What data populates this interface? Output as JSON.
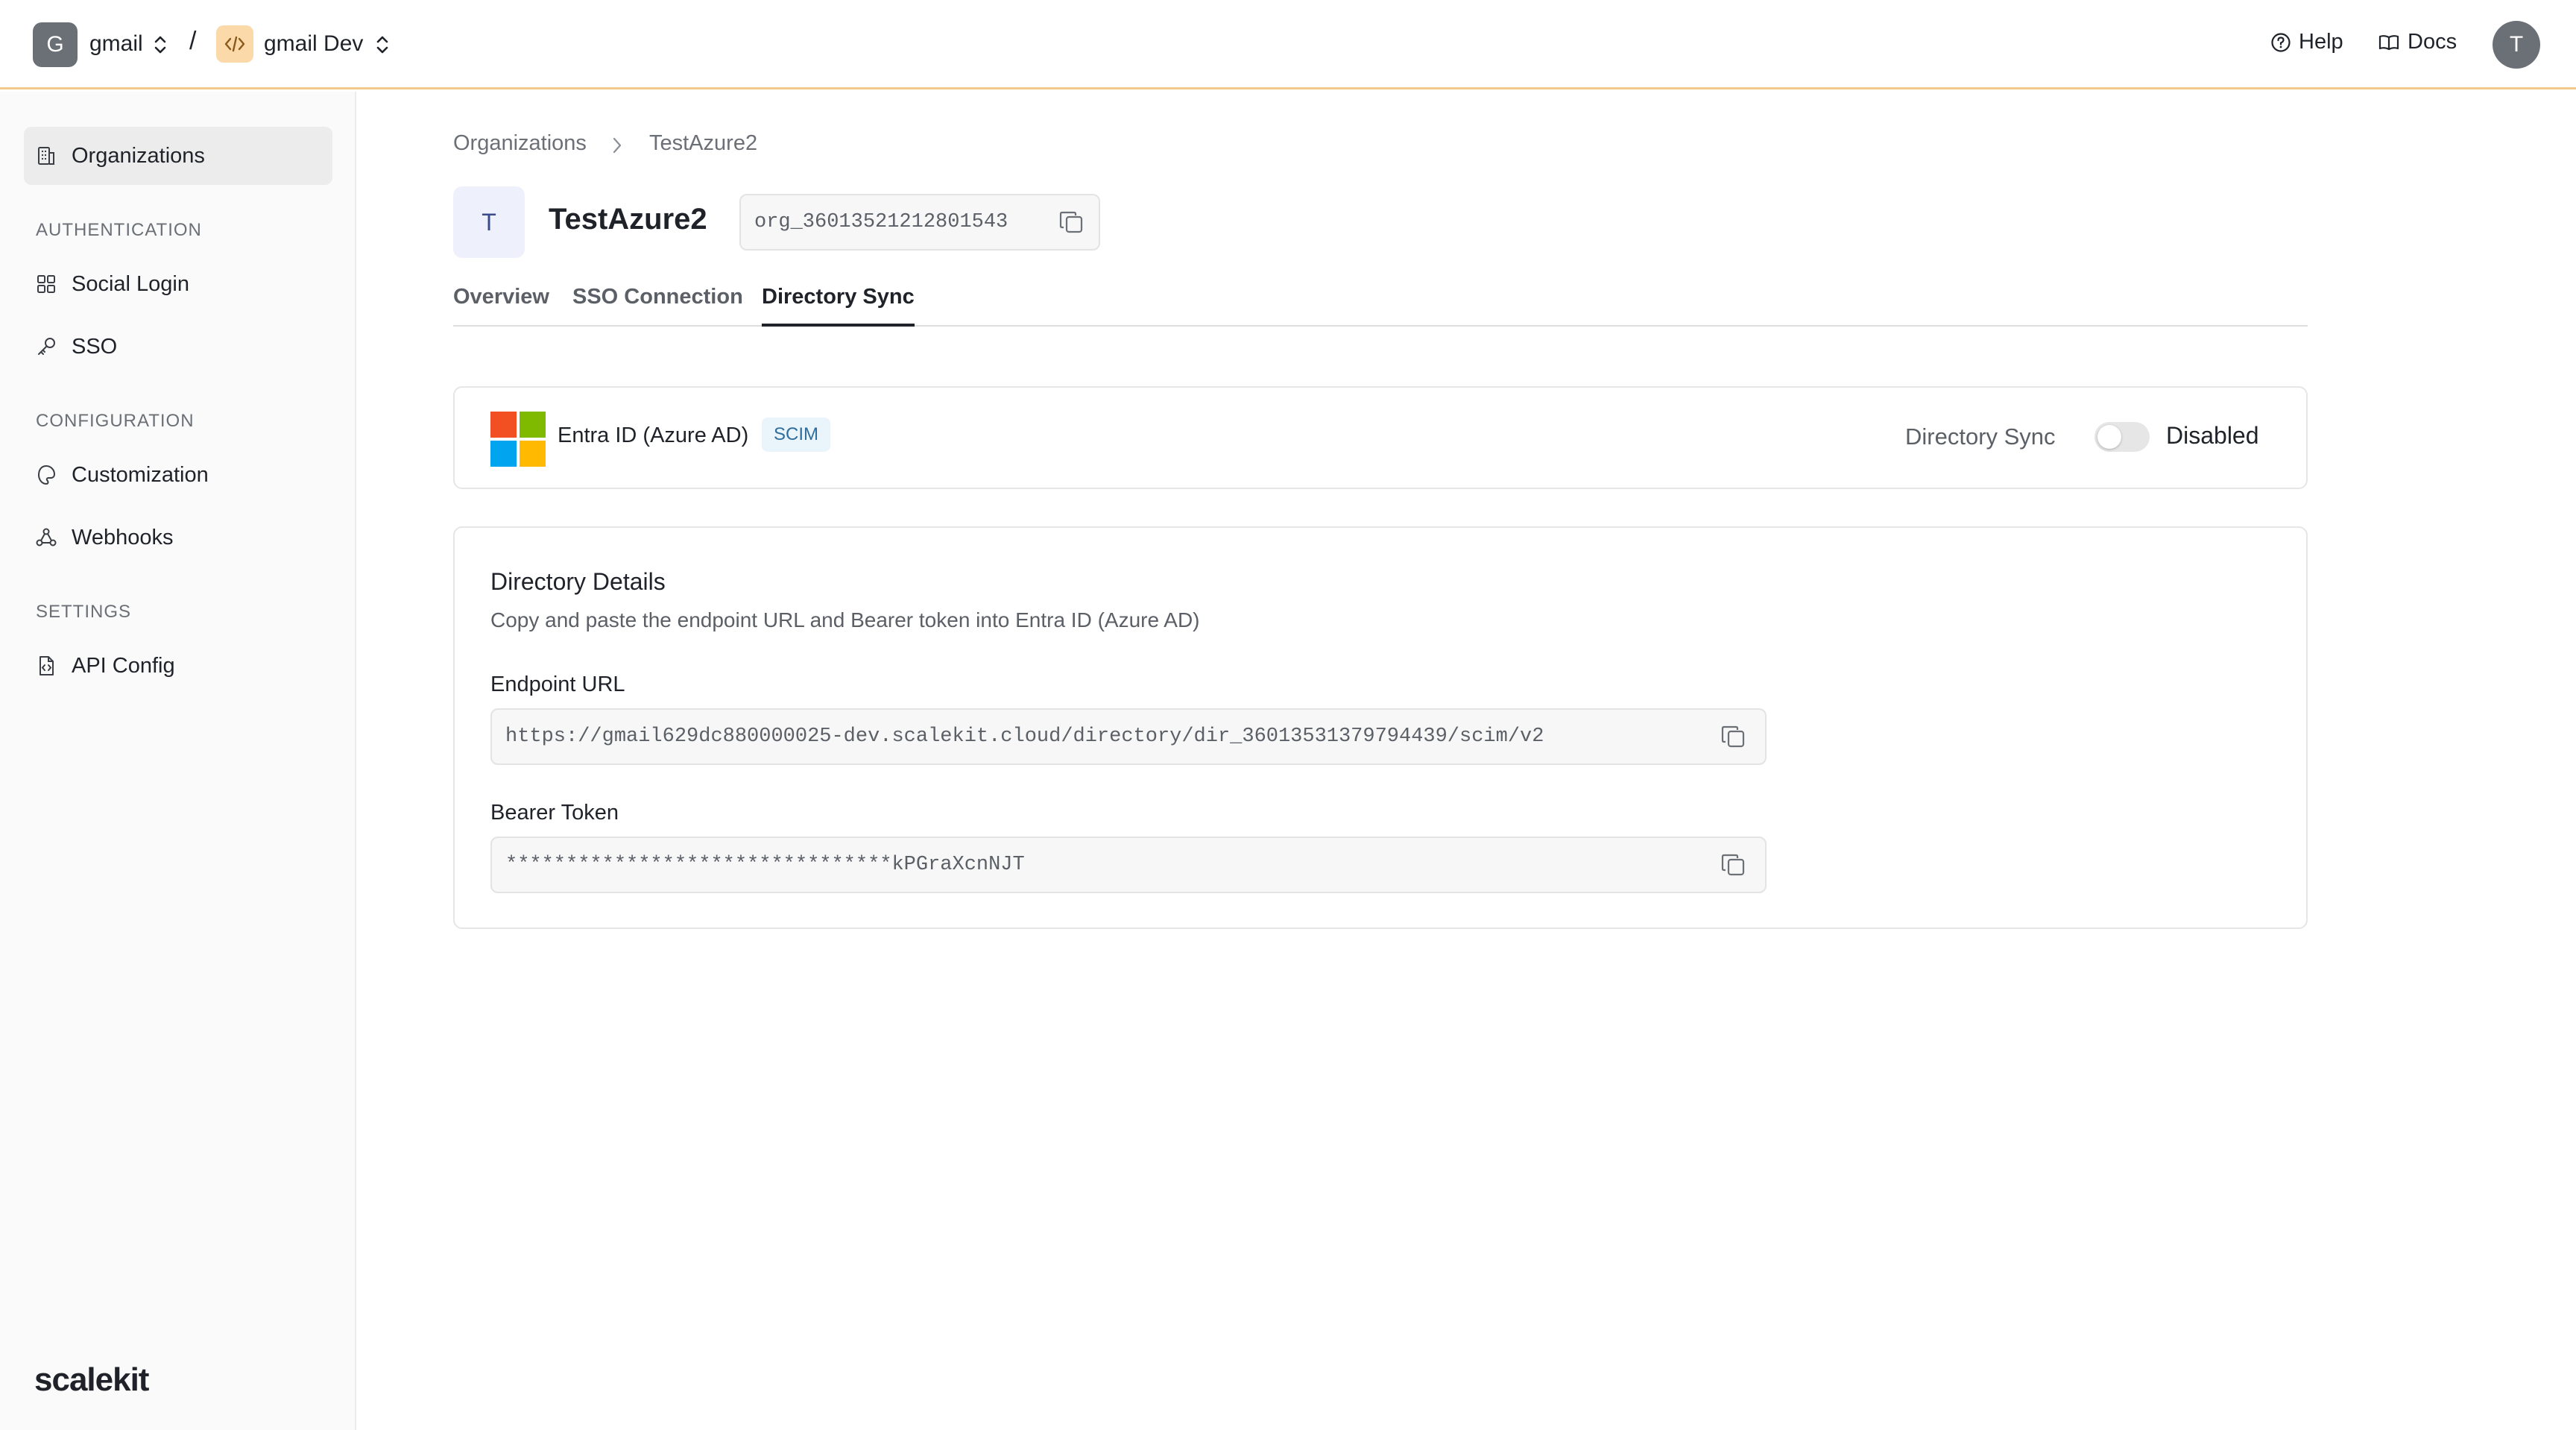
{
  "topbar": {
    "workspace_initial": "G",
    "workspace_name": "gmail",
    "separator": "/",
    "environment_name": "gmail Dev",
    "help_label": "Help",
    "docs_label": "Docs",
    "user_initial": "T",
    "accent_color": "#f1c98b"
  },
  "sidebar": {
    "organizations_label": "Organizations",
    "sections": {
      "authentication": "AUTHENTICATION",
      "configuration": "CONFIGURATION",
      "settings": "SETTINGS"
    },
    "items": {
      "social_login": "Social Login",
      "sso": "SSO",
      "customization": "Customization",
      "webhooks": "Webhooks",
      "api_config": "API Config"
    },
    "brand": "scalekit"
  },
  "breadcrumb": {
    "parent": "Organizations",
    "current": "TestAzure2"
  },
  "org": {
    "initial": "T",
    "name": "TestAzure2",
    "id": "org_36013521212801543"
  },
  "tabs": {
    "overview": "Overview",
    "sso_connection": "SSO Connection",
    "directory_sync": "Directory Sync",
    "active": "directory_sync"
  },
  "provider": {
    "name": "Entra ID (Azure AD)",
    "badge": "SCIM",
    "icon": "microsoft-logo-icon",
    "sync_label": "Directory Sync",
    "sync_enabled": false,
    "sync_status": "Disabled"
  },
  "details": {
    "title": "Directory Details",
    "subtitle": "Copy and paste the endpoint URL and Bearer token into Entra ID (Azure AD)",
    "endpoint_label": "Endpoint URL",
    "endpoint_value": "https://gmail629dc880000025-dev.scalekit.cloud/directory/dir_36013531379794439/scim/v2",
    "token_label": "Bearer Token",
    "token_value": "********************************kPGraXcnNJT"
  }
}
